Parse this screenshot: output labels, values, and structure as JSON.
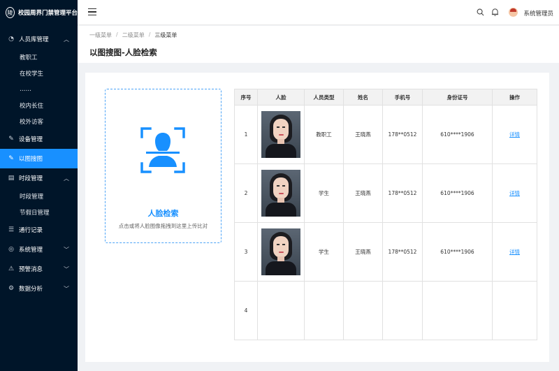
{
  "app": {
    "title": "校园周界门禁管理平台",
    "logo_char": "陵"
  },
  "sidebar": {
    "items": [
      {
        "label": "人员库管理",
        "icon": "dashboard-icon",
        "expanded": true
      },
      {
        "label": "教职工",
        "sub": true
      },
      {
        "label": "在校学生",
        "sub": true
      },
      {
        "label": "……",
        "sub": true
      },
      {
        "label": "校内长住",
        "sub": true
      },
      {
        "label": "校外访客",
        "sub": true
      },
      {
        "label": "设备管理",
        "icon": "edit-icon"
      },
      {
        "label": "以图搜图",
        "icon": "edit-icon",
        "active": true
      },
      {
        "label": "时段管理",
        "icon": "table-icon"
      },
      {
        "label": "时段管理",
        "sub": true
      },
      {
        "label": "节假日管理",
        "sub": true
      },
      {
        "label": "通行记录",
        "icon": "list-icon"
      },
      {
        "label": "系统管理",
        "icon": "check-circle-icon"
      },
      {
        "label": "预警消息",
        "icon": "warning-icon"
      },
      {
        "label": "数据分析",
        "icon": "settings-icon"
      }
    ]
  },
  "header": {
    "user_name": "系统管理员"
  },
  "breadcrumb": {
    "level1": "一级菜单",
    "level2": "二级菜单",
    "level3": "三级菜单",
    "sep": "/"
  },
  "page": {
    "title": "以图搜图-人脸检索"
  },
  "upload": {
    "title": "人脸检索",
    "desc": "点击或将人脸图像拖拽到这里上传比对"
  },
  "table": {
    "headers": [
      "序号",
      "人脸",
      "人员类型",
      "姓名",
      "手机号",
      "身份证号",
      "操作"
    ],
    "rows": [
      {
        "no": "1",
        "type": "教职工",
        "name": "王晓燕",
        "phone": "178**0512",
        "id": "610****1906",
        "action": "详情"
      },
      {
        "no": "2",
        "type": "学生",
        "name": "王晓燕",
        "phone": "178**0512",
        "id": "610****1906",
        "action": "详情"
      },
      {
        "no": "3",
        "type": "学生",
        "name": "王晓燕",
        "phone": "178**0512",
        "id": "610****1906",
        "action": "详情"
      },
      {
        "no": "4",
        "type": "",
        "name": "",
        "phone": "",
        "id": "",
        "action": ""
      }
    ]
  },
  "colors": {
    "sidebar_bg": "#001529",
    "accent": "#1890ff",
    "page_bg": "#f0f2f5"
  }
}
